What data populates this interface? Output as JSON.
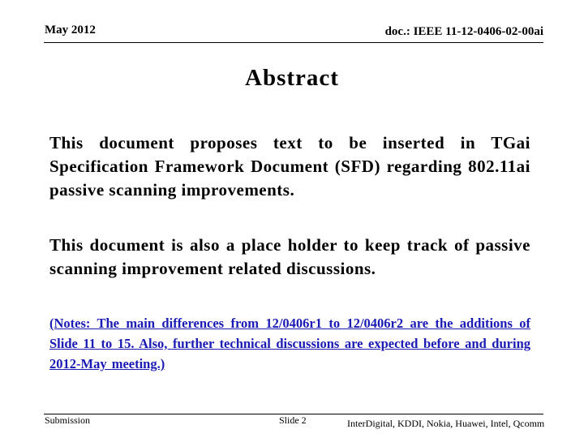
{
  "header": {
    "date": "May 2012",
    "doc_id": "doc.: IEEE 11-12-0406-02-00ai"
  },
  "slide": {
    "title": "Abstract",
    "paragraphs": [
      "This document proposes text to be inserted in TGai Specification Framework Document (SFD) regarding 802.11ai passive scanning improvements.",
      "This document is also a place holder to keep track of passive scanning improvement related discussions."
    ],
    "note": "(Notes: The main differences from 12/0406r1 to 12/0406r2 are the additions of Slide 11 to 15. Also, further technical discussions are expected before and during 2012-May meeting.)",
    "note_color": "#1a1ab5"
  },
  "footer": {
    "left": "Submission",
    "center": "Slide 2",
    "right": "InterDigital, KDDI, Nokia, Huawei, Intel, Qcomm"
  }
}
